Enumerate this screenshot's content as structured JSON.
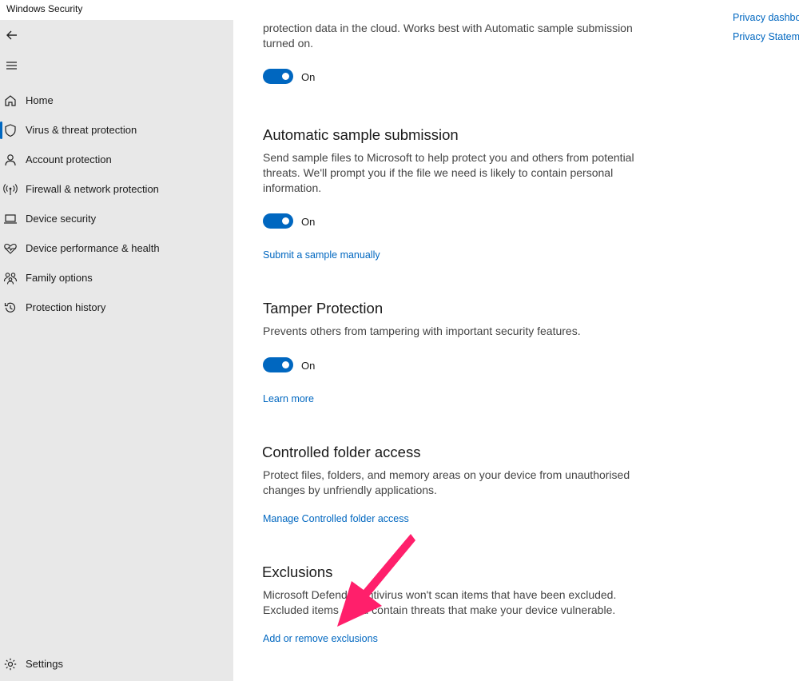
{
  "window": {
    "title": "Windows Security"
  },
  "sidebar": {
    "items": [
      {
        "label": "Home",
        "icon": "home-icon"
      },
      {
        "label": "Virus & threat protection",
        "icon": "shield-icon",
        "active": true
      },
      {
        "label": "Account protection",
        "icon": "person-icon"
      },
      {
        "label": "Firewall & network protection",
        "icon": "antenna-icon"
      },
      {
        "label": "Device security",
        "icon": "laptop-icon"
      },
      {
        "label": "Device performance & health",
        "icon": "heart-pulse-icon"
      },
      {
        "label": "Family options",
        "icon": "family-icon"
      },
      {
        "label": "Protection history",
        "icon": "history-icon"
      }
    ],
    "settings_label": "Settings"
  },
  "right_links": {
    "privacy_dashboard": "Privacy dashbo",
    "privacy_statement": "Privacy Statem"
  },
  "sections": {
    "cloud": {
      "description": "protection data in the cloud. Works best with Automatic sample submission turned on.",
      "toggle": "On"
    },
    "sample": {
      "title": "Automatic sample submission",
      "description": "Send sample files to Microsoft to help protect you and others from potential threats. We'll prompt you if the file we need is likely to contain personal information.",
      "toggle": "On",
      "link": "Submit a sample manually"
    },
    "tamper": {
      "title": "Tamper Protection",
      "description": "Prevents others from tampering with important security features.",
      "toggle": "On",
      "link": "Learn more"
    },
    "folder": {
      "title": "Controlled folder access",
      "description": "Protect files, folders, and memory areas on your device from unauthorised changes by unfriendly applications.",
      "link": "Manage Controlled folder access"
    },
    "exclusions": {
      "title": "Exclusions",
      "description": "Microsoft Defender Antivirus won't scan items that have been excluded. Excluded items could contain threats that make your device vulnerable.",
      "link": "Add or remove exclusions"
    }
  },
  "colors": {
    "accent": "#0067c0",
    "sidebar_bg": "#e8e8e8",
    "annotation": "#ff1f6b"
  }
}
